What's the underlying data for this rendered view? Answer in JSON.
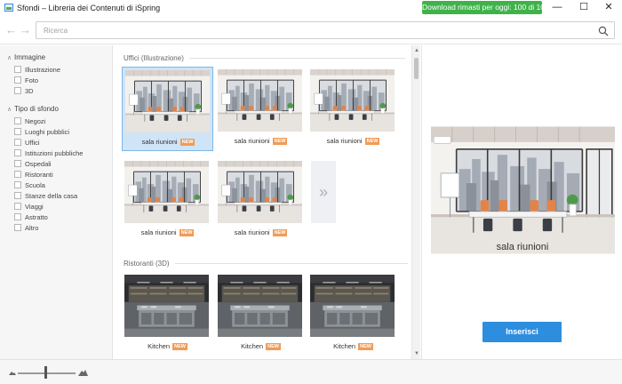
{
  "window": {
    "title": "Sfondi – Libreria dei Contenuti di iSpring",
    "download_badge": "Download rimasti per oggi: 100 di 100",
    "minimize_icon": "—",
    "maximize_icon": "☐",
    "close_icon": "✕"
  },
  "toolbar": {
    "back_icon": "←",
    "forward_icon": "→",
    "search_placeholder": "Ricerca",
    "search_value": ""
  },
  "sidebar": {
    "groups": [
      {
        "label": "Immagine",
        "caret": "∧",
        "items": [
          {
            "label": "Illustrazione",
            "checked": false
          },
          {
            "label": "Foto",
            "checked": false
          },
          {
            "label": "3D",
            "checked": false
          }
        ]
      },
      {
        "label": "Tipo di sfondo",
        "caret": "∧",
        "items": [
          {
            "label": "Negozi",
            "checked": false
          },
          {
            "label": "Luoghi pubblici",
            "checked": false
          },
          {
            "label": "Uffici",
            "checked": false
          },
          {
            "label": "Istituzioni pubbliche",
            "checked": false
          },
          {
            "label": "Ospedali",
            "checked": false
          },
          {
            "label": "Ristoranti",
            "checked": false
          },
          {
            "label": "Scuola",
            "checked": false
          },
          {
            "label": "Stanze della casa",
            "checked": false
          },
          {
            "label": "Viaggi",
            "checked": false
          },
          {
            "label": "Astratto",
            "checked": false
          },
          {
            "label": "Altro",
            "checked": false
          }
        ]
      }
    ]
  },
  "gallery": {
    "sections": [
      {
        "title": "Uffici (Illustrazione)",
        "items": [
          {
            "caption": "sala riunioni",
            "badge": "NEW",
            "selected": true
          },
          {
            "caption": "sala riunioni",
            "badge": "NEW",
            "selected": false
          },
          {
            "caption": "sala riunioni",
            "badge": "NEW",
            "selected": false
          },
          {
            "caption": "sala riunioni",
            "badge": "NEW",
            "selected": false
          },
          {
            "caption": "sala riunioni",
            "badge": "NEW",
            "selected": false
          }
        ],
        "more_icon": "»"
      },
      {
        "title": "Ristoranti (3D)",
        "items": [
          {
            "caption": "Kitchen",
            "badge": "NEW",
            "selected": false
          },
          {
            "caption": "Kitchen",
            "badge": "NEW",
            "selected": false
          },
          {
            "caption": "Kitchen",
            "badge": "NEW",
            "selected": false
          }
        ]
      }
    ]
  },
  "preview": {
    "title": "sala riunioni",
    "insert_label": "Inserisci"
  },
  "colors": {
    "accent": "#2d8ee0",
    "badge_green": "#3fb24a",
    "new_tag": "#f29b55",
    "selection": "#cfe4f7"
  }
}
